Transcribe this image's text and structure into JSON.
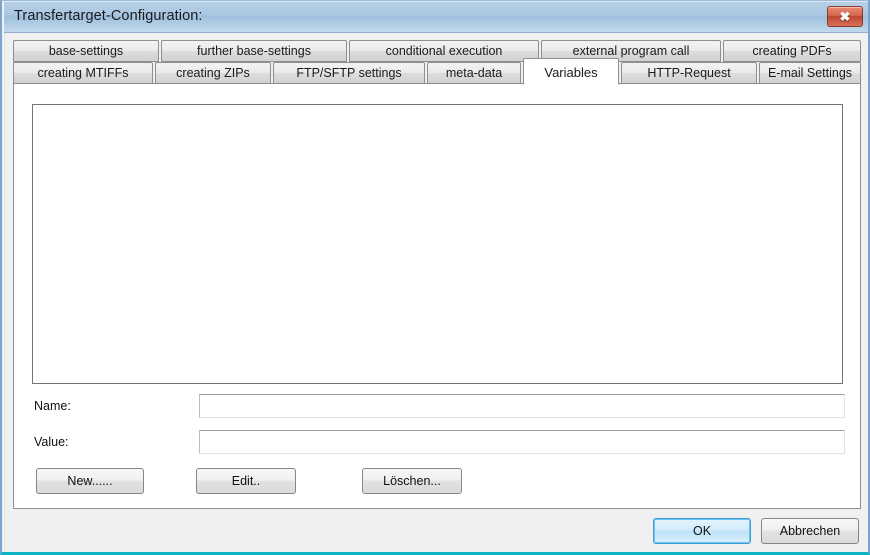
{
  "window": {
    "title": "Transfertarget-Configuration:",
    "close_icon": "close-icon",
    "close_glyph": "✖",
    "titlebar_color": "#aac7e2",
    "accent_bottom_color": "#0cb4c4"
  },
  "tabs": {
    "row1": [
      {
        "label": "base-settings",
        "selected": false
      },
      {
        "label": "further base-settings",
        "selected": false
      },
      {
        "label": "conditional execution",
        "selected": false
      },
      {
        "label": "external program call",
        "selected": false
      },
      {
        "label": "creating PDFs",
        "selected": false
      }
    ],
    "row2": [
      {
        "label": "creating MTIFFs",
        "selected": false
      },
      {
        "label": "creating ZIPs",
        "selected": false
      },
      {
        "label": "FTP/SFTP settings",
        "selected": false
      },
      {
        "label": "meta-data",
        "selected": false
      },
      {
        "label": "Variables",
        "selected": true
      },
      {
        "label": "HTTP-Request",
        "selected": false
      },
      {
        "label": "E-mail Settings",
        "selected": false
      }
    ],
    "active": "Variables"
  },
  "panel": {
    "variable_list": {
      "items": [],
      "empty": true
    },
    "fields": {
      "name_label": "Name:",
      "name_value": "",
      "name_placeholder": "",
      "value_label": "Value:",
      "value_value": "",
      "value_placeholder": ""
    },
    "buttons": {
      "new": "New......",
      "edit": "Edit..",
      "delete": "Löschen..."
    }
  },
  "footer": {
    "ok": "OK",
    "cancel": "Abbrechen"
  }
}
